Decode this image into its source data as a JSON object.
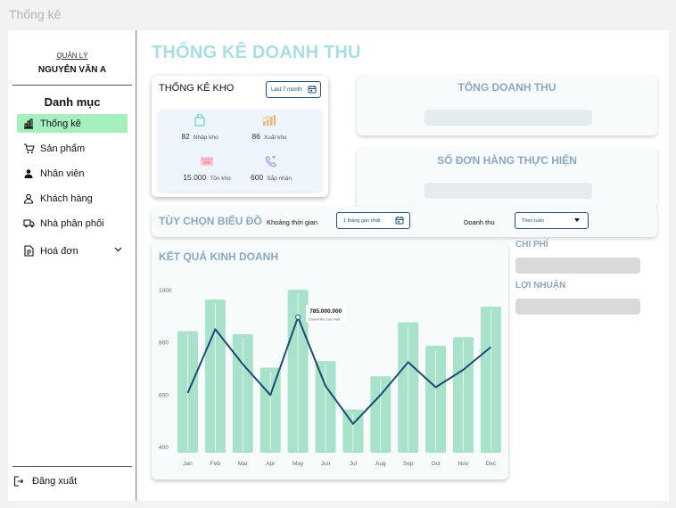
{
  "window": {
    "title": "Thống kê"
  },
  "sidebar": {
    "role": "QUẢN LÝ",
    "user_name": "NGUYỄN VĂN A",
    "menu_title": "Danh mục",
    "items": [
      {
        "label": "Thống kê",
        "icon": "bar-chart-icon",
        "active": true
      },
      {
        "label": "Sản phẩm",
        "icon": "cart-icon"
      },
      {
        "label": "Nhân viên",
        "icon": "person-filled-icon"
      },
      {
        "label": "Khách hàng",
        "icon": "person-outline-icon"
      },
      {
        "label": "Nhà phân phối",
        "icon": "truck-icon"
      },
      {
        "label": "Hoá đơn",
        "icon": "document-icon",
        "expandable": true
      }
    ],
    "logout_label": "Đăng xuất"
  },
  "main": {
    "page_title": "THỐNG KÊ DOANH THU",
    "kho": {
      "title": "THỐNG KÊ KHO",
      "range_label": "Last 7 month",
      "stats": [
        {
          "value": "82",
          "label": "Nhập kho",
          "icon": "bag-icon",
          "color": "#5fd3e6"
        },
        {
          "value": "86",
          "label": "Xuất kho",
          "icon": "growth-chart-icon",
          "color": "#f5b66b"
        },
        {
          "value": "15.000",
          "label": "Tồn kho",
          "icon": "inventory-box-icon",
          "color": "#f29ab0"
        },
        {
          "value": "600",
          "label": "Sắp nhận",
          "icon": "incoming-phone-icon",
          "color": "#a18ff2"
        }
      ]
    },
    "total_revenue_title": "TỔNG DOANH THU",
    "orders_title": "SỐ ĐƠN HÀNG THỰC HIỆN",
    "options": {
      "title": "TÙY CHỌN BIỂU ĐỒ",
      "period_label": "Khoảng thời gian",
      "period_value": "1 tháng gần nhất",
      "metric_label": "Doanh thu",
      "metric_value": "Theo tuần"
    },
    "chart_title": "KẾT QUẢ KINH DOANH",
    "side": {
      "cost_label": "CHI PHÍ",
      "profit_label": "LỢI NHUẬN"
    }
  },
  "colors": {
    "accent": "#a9dde7",
    "active_menu": "#a6efbe",
    "bar": "#a8e2cb",
    "line": "#1b4c74",
    "card_title": "#8aa8c6"
  },
  "chart_data": {
    "type": "bar",
    "categories": [
      "Jan",
      "Feb",
      "Mar",
      "Apr",
      "May",
      "Jun",
      "Jul",
      "Aug",
      "Sep",
      "Oct",
      "Nov",
      "Dec"
    ],
    "series": [
      {
        "type": "bar",
        "values": [
          845,
          966,
          833,
          705,
          1003,
          730,
          545,
          672,
          878,
          789,
          822,
          938
        ]
      },
      {
        "type": "line",
        "values": [
          608,
          852,
          718,
          600,
          898,
          635,
          490,
          601,
          726,
          630,
          697,
          784
        ]
      }
    ],
    "ylim": [
      400,
      1000
    ],
    "yticks": [
      400,
      600,
      800,
      1000
    ],
    "tooltip": {
      "category": "May",
      "value": "785.000.000",
      "label": "Doanh thu cao nhất"
    }
  }
}
